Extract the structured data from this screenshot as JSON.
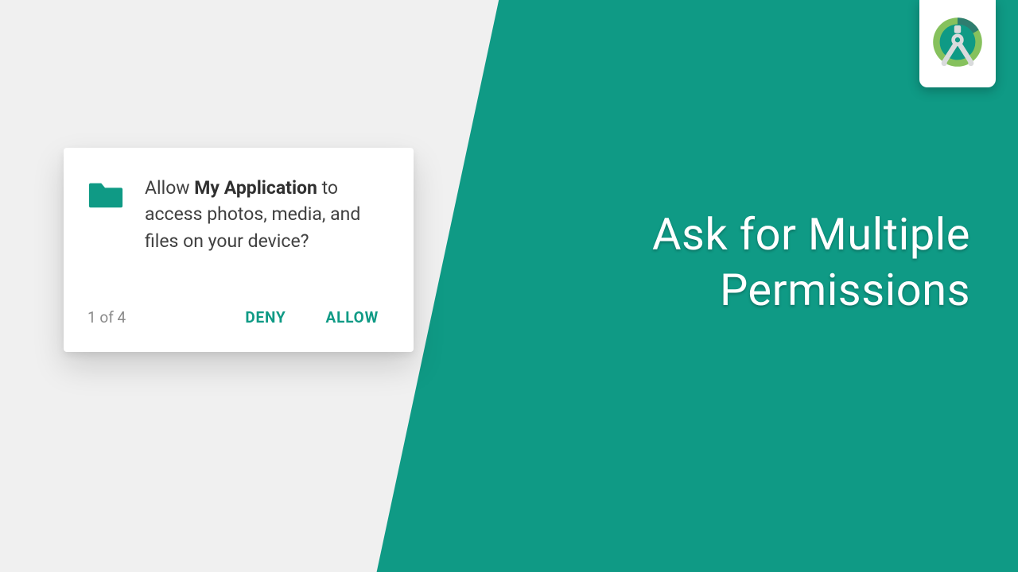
{
  "headline": {
    "line1": "Ask for Multiple",
    "line2": "Permissions"
  },
  "dialog": {
    "prefix": "Allow ",
    "app_name": "My Application",
    "suffix": " to access photos, media, and files on your device?",
    "counter": "1 of 4",
    "deny_label": "DENY",
    "allow_label": "ALLOW"
  },
  "colors": {
    "accent": "#0f9a85"
  }
}
